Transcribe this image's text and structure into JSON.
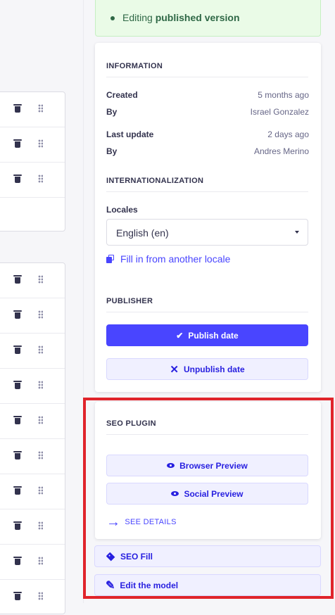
{
  "banner": {
    "prefix": "Editing",
    "emph": "published version"
  },
  "information": {
    "heading": "INFORMATION",
    "created_label": "Created",
    "created_value": "5 months ago",
    "created_by_label": "By",
    "created_by_value": "Israel Gonzalez",
    "updated_label": "Last update",
    "updated_value": "2 days ago",
    "updated_by_label": "By",
    "updated_by_value": "Andres Merino"
  },
  "i18n": {
    "heading": "INTERNATIONALIZATION",
    "locales_label": "Locales",
    "locale_value": "English (en)",
    "fill_link": "Fill in from another locale"
  },
  "publisher": {
    "heading": "PUBLISHER",
    "publish_label": "Publish date",
    "unpublish_label": "Unpublish date"
  },
  "seo": {
    "heading": "SEO PLUGIN",
    "browser_preview": "Browser Preview",
    "social_preview": "Social Preview",
    "see_details": "SEE DETAILS"
  },
  "actions": {
    "seo_fill": "SEO Fill",
    "edit_model": "Edit the model"
  },
  "icons": {
    "row_delete": "trash-icon",
    "row_drag": "drag-handle-icon",
    "status": "dot-icon",
    "select": "caret-down-icon",
    "fill": "copy-icon",
    "publish": "check-icon",
    "unpublish": "cross-icon",
    "preview": "eye-icon",
    "details": "arrow-right-icon",
    "seo_fill": "tag-icon",
    "edit": "pencil-icon"
  },
  "colors": {
    "primary": "#4945ff",
    "success_bg": "#eafbe7",
    "success_text": "#2f6846",
    "highlight": "#e0242b"
  }
}
